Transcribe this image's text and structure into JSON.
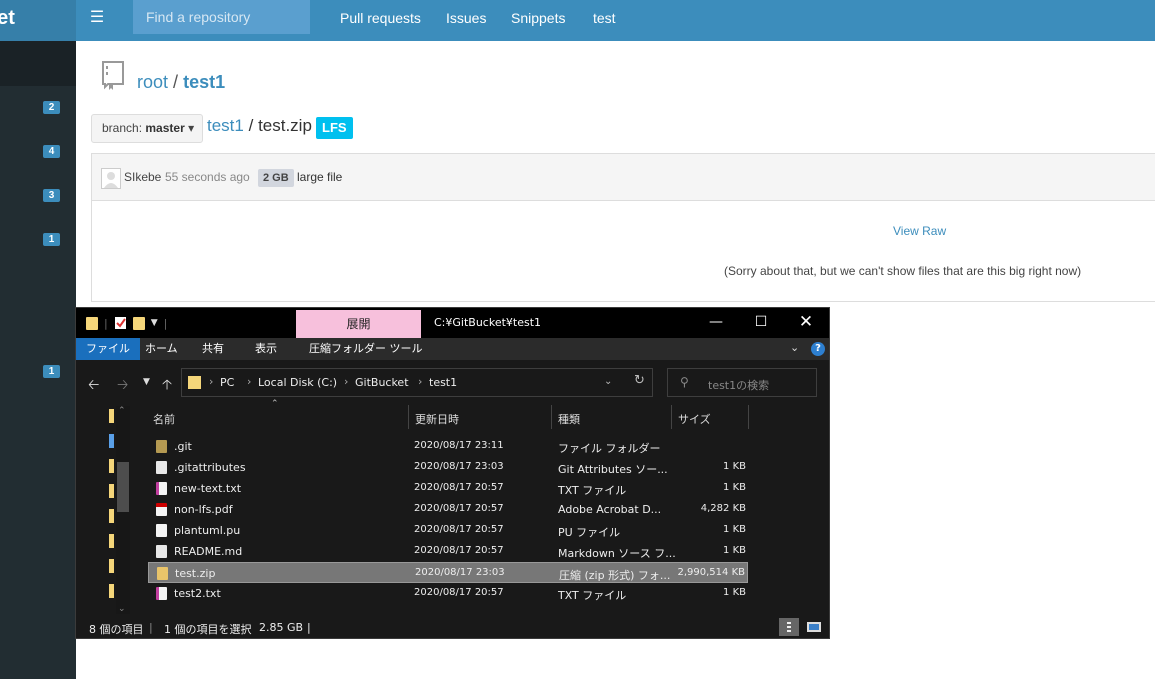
{
  "topbar": {
    "brand": "ket",
    "search_placeholder": "Find a repository",
    "nav": [
      "Pull requests",
      "Issues",
      "Snippets",
      "test"
    ]
  },
  "sidebar": {
    "badges": [
      "2",
      "4",
      "3",
      "1",
      "1"
    ]
  },
  "repo": {
    "owner": "root",
    "separator": "/",
    "name": "test1"
  },
  "branch": {
    "label": "branch:",
    "value": "master"
  },
  "file": {
    "repo_link": "test1",
    "separator": "/",
    "filename": "test.zip",
    "badge": "LFS"
  },
  "commit": {
    "author": "SIkebe",
    "time": "55 seconds ago",
    "size": "2 GB",
    "message": "large file"
  },
  "content": {
    "view_raw": "View Raw",
    "notice": "(Sorry about that, but we can't show files that are this big right now)"
  },
  "explorer": {
    "title": "C:¥GitBucket¥test1",
    "context_tab": "展開",
    "ribbon_tabs": [
      "ファイル",
      "ホーム",
      "共有",
      "表示",
      "圧縮フォルダー ツール"
    ],
    "breadcrumb": [
      "PC",
      "Local Disk (C:)",
      "GitBucket",
      "test1"
    ],
    "search_placeholder": "test1の検索",
    "columns": [
      "名前",
      "更新日時",
      "種類",
      "サイズ"
    ],
    "files": [
      {
        "name": ".git",
        "date": "2020/08/17 23:11",
        "type": "ファイル フォルダー",
        "size": "",
        "icon": "folder-icon"
      },
      {
        "name": ".gitattributes",
        "date": "2020/08/17 23:03",
        "type": "Git Attributes ソー...",
        "size": "1 KB",
        "icon": "gear-file-icon"
      },
      {
        "name": "new-text.txt",
        "date": "2020/08/17 20:57",
        "type": "TXT ファイル",
        "size": "1 KB",
        "icon": "text-file-icon"
      },
      {
        "name": "non-lfs.pdf",
        "date": "2020/08/17 20:57",
        "type": "Adobe Acrobat D...",
        "size": "4,282 KB",
        "icon": "pdf-file-icon"
      },
      {
        "name": "plantuml.pu",
        "date": "2020/08/17 20:57",
        "type": "PU ファイル",
        "size": "1 KB",
        "icon": "blank-file-icon"
      },
      {
        "name": "README.md",
        "date": "2020/08/17 20:57",
        "type": "Markdown ソース フ...",
        "size": "1 KB",
        "icon": "markdown-file-icon"
      },
      {
        "name": "test.zip",
        "date": "2020/08/17 23:03",
        "type": "圧縮 (zip 形式) フォ...",
        "size": "2,990,514 KB",
        "icon": "zip-file-icon"
      },
      {
        "name": "test2.txt",
        "date": "2020/08/17 20:57",
        "type": "TXT ファイル",
        "size": "1 KB",
        "icon": "text-file-icon"
      }
    ],
    "status": {
      "count": "8 個の項目",
      "selected": "1 個の項目を選択",
      "selected_size": "2.85 GB"
    }
  },
  "colors": {
    "header": "#3c8dbc",
    "sidebar": "#222d32",
    "lfs": "#00c0ef",
    "context_tab": "#f7c0dc"
  }
}
